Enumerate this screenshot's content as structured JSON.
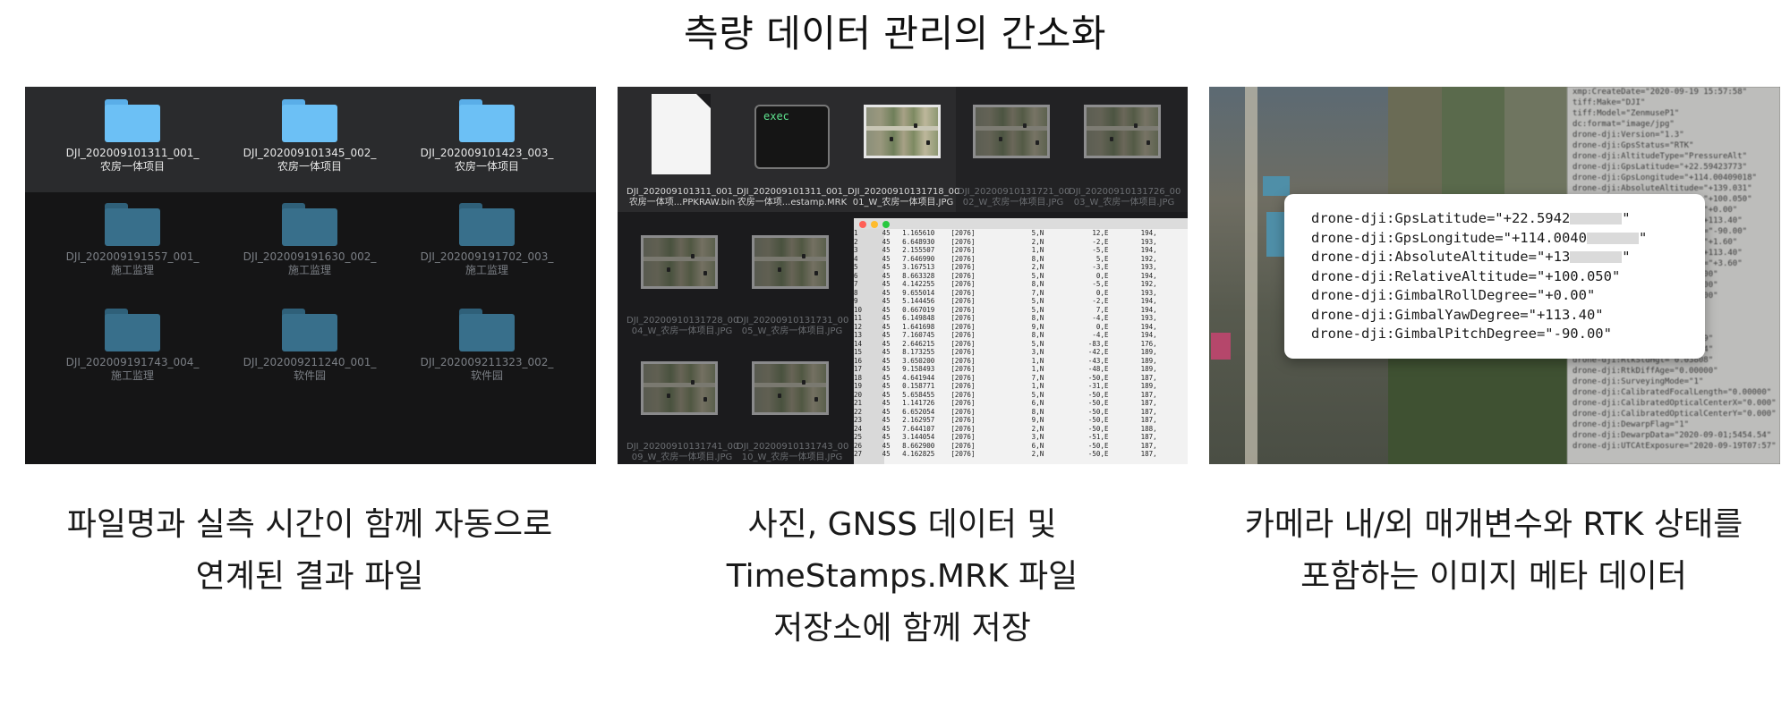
{
  "page": {
    "title": "측량 데이터 관리의 간소화"
  },
  "panels": [
    {
      "caption": [
        "파일명과 실측 시간이 함께 자동으로",
        "연계된 결과 파일"
      ],
      "folders": [
        {
          "line1": "DJI_202009101311_001_",
          "line2": "农房一体项目",
          "active": true
        },
        {
          "line1": "DJI_202009101345_002_",
          "line2": "农房一体项目",
          "active": true
        },
        {
          "line1": "DJI_202009101423_003_",
          "line2": "农房一体项目",
          "active": true
        },
        {
          "line1": "DJI_202009191557_001_",
          "line2": "施工监理",
          "active": false
        },
        {
          "line1": "DJI_202009191630_002_",
          "line2": "施工监理",
          "active": false
        },
        {
          "line1": "DJI_202009191702_003_",
          "line2": "施工监理",
          "active": false
        },
        {
          "line1": "DJI_202009191743_004_",
          "line2": "施工监理",
          "active": false
        },
        {
          "line1": "DJI_202009211240_001_",
          "line2": "软件园",
          "active": false
        },
        {
          "line1": "DJI_202009211323_002_",
          "line2": "软件园",
          "active": false
        }
      ]
    },
    {
      "caption": [
        "사진, GNSS 데이터 및",
        "TimeStamps.MRK 파일",
        "저장소에 함께 저장"
      ],
      "terminal_label": "exec",
      "files": [
        {
          "line1": "DJI_202009101311_001_",
          "line2": "农房一体项...PPKRAW.bin"
        },
        {
          "line1": "DJI_202009101311_001_",
          "line2": "农房一体项...estamp.MRK"
        },
        {
          "line1": "DJI_20200910131718_00",
          "line2": "01_W_农房一体项目.JPG"
        },
        {
          "line1": "DJI_20200910131721_00",
          "line2": "02_W_农房一体项目.JPG"
        },
        {
          "line1": "DJI_20200910131726_00",
          "line2": "03_W_农房一体项目.JPG"
        },
        {
          "line1": "DJI_20200910131728_00",
          "line2": "04_W_农房一体项目.JPG"
        },
        {
          "line1": "DJI_20200910131731_00",
          "line2": "05_W_农房一体项目.JPG"
        },
        {
          "line1": "DJI_20200910131741_00",
          "line2": "09_W_农房一体项目.JPG"
        },
        {
          "line1": "DJI_20200910131743_00",
          "line2": "10_W_农房一体项目.JPG"
        }
      ],
      "mrk_rows": [
        [
          "1",
          "45",
          "1.165610",
          "[2076]",
          "5,N",
          "12,E",
          "194,"
        ],
        [
          "2",
          "45",
          "6.648930",
          "[2076]",
          "2,N",
          "-2,E",
          "193,"
        ],
        [
          "3",
          "45",
          "2.155507",
          "[2076]",
          "1,N",
          "-5,E",
          "194,"
        ],
        [
          "4",
          "45",
          "7.646990",
          "[2076]",
          "8,N",
          "5,E",
          "192,"
        ],
        [
          "5",
          "45",
          "3.167513",
          "[2076]",
          "2,N",
          "-3,E",
          "193,"
        ],
        [
          "6",
          "45",
          "8.663328",
          "[2076]",
          "5,N",
          "0,E",
          "194,"
        ],
        [
          "7",
          "45",
          "4.142255",
          "[2076]",
          "8,N",
          "-5,E",
          "192,"
        ],
        [
          "8",
          "45",
          "9.655014",
          "[2076]",
          "7,N",
          "0,E",
          "193,"
        ],
        [
          "9",
          "45",
          "5.144456",
          "[2076]",
          "5,N",
          "-2,E",
          "194,"
        ],
        [
          "10",
          "45",
          "0.667019",
          "[2076]",
          "5,N",
          "7,E",
          "194,"
        ],
        [
          "11",
          "45",
          "6.149848",
          "[2076]",
          "8,N",
          "-4,E",
          "193,"
        ],
        [
          "12",
          "45",
          "1.641698",
          "[2076]",
          "9,N",
          "0,E",
          "194,"
        ],
        [
          "13",
          "45",
          "7.160745",
          "[2076]",
          "8,N",
          "-4,E",
          "194,"
        ],
        [
          "14",
          "45",
          "2.646215",
          "[2076]",
          "5,N",
          "-83,E",
          "176,"
        ],
        [
          "15",
          "45",
          "8.173255",
          "[2076]",
          "3,N",
          "-42,E",
          "189,"
        ],
        [
          "16",
          "45",
          "3.650200",
          "[2076]",
          "1,N",
          "-43,E",
          "189,"
        ],
        [
          "17",
          "45",
          "9.158493",
          "[2076]",
          "1,N",
          "-48,E",
          "189,"
        ],
        [
          "18",
          "45",
          "4.641944",
          "[2076]",
          "7,N",
          "-50,E",
          "187,"
        ],
        [
          "19",
          "45",
          "0.158771",
          "[2076]",
          "1,N",
          "-31,E",
          "189,"
        ],
        [
          "20",
          "45",
          "5.658455",
          "[2076]",
          "5,N",
          "-50,E",
          "187,"
        ],
        [
          "21",
          "45",
          "1.141726",
          "[2076]",
          "6,N",
          "-50,E",
          "187,"
        ],
        [
          "22",
          "45",
          "6.652054",
          "[2076]",
          "8,N",
          "-50,E",
          "187,"
        ],
        [
          "23",
          "45",
          "2.162957",
          "[2076]",
          "9,N",
          "-50,E",
          "187,"
        ],
        [
          "24",
          "45",
          "7.644107",
          "[2076]",
          "2,N",
          "-50,E",
          "188,"
        ],
        [
          "25",
          "45",
          "3.144054",
          "[2076]",
          "3,N",
          "-51,E",
          "187,"
        ],
        [
          "26",
          "45",
          "8.662900",
          "[2076]",
          "6,N",
          "-50,E",
          "187,"
        ],
        [
          "27",
          "45",
          "4.162825",
          "[2076]",
          "2,N",
          "-50,E",
          "187,"
        ]
      ]
    },
    {
      "caption": [
        "카메라 내/외 매개변수와 RTK 상태를",
        "포함하는 이미지 메타 데이터"
      ],
      "card_lines": [
        {
          "prefix": "drone-dji:GpsLatitude=\"+22.5942",
          "masked": true,
          "suffix": "\""
        },
        {
          "prefix": "drone-dji:GpsLongitude=\"+114.0040",
          "masked": true,
          "suffix": "\""
        },
        {
          "prefix": "drone-dji:AbsoluteAltitude=\"+13",
          "masked": true,
          "suffix": "\""
        },
        {
          "prefix": "drone-dji:RelativeAltitude=\"+100.050\"",
          "masked": false,
          "suffix": ""
        },
        {
          "prefix": "drone-dji:GimbalRollDegree=\"+0.00\"",
          "masked": false,
          "suffix": ""
        },
        {
          "prefix": "drone-dji:GimbalYawDegree=\"+113.40\"",
          "masked": false,
          "suffix": ""
        },
        {
          "prefix": "drone-dji:GimbalPitchDegree=\"-90.00\"",
          "masked": false,
          "suffix": ""
        }
      ],
      "background_meta": [
        "xmp:CreateDate=\"2020-09-19 15:57:58\"",
        "tiff:Make=\"DJI\"",
        "tiff:Model=\"ZenmuseP1\"",
        "dc:format=\"image/jpg\"",
        "drone-dji:Version=\"1.3\"",
        "drone-dji:GpsStatus=\"RTK\"",
        "drone-dji:AltitudeType=\"PressureAlt\"",
        "drone-dji:GpsLatitude=\"+22.59423773\"",
        "drone-dji:GpsLongitude=\"+114.00409018\"",
        "drone-dji:AbsoluteAltitude=\"+139.031\"",
        "drone-dji:RelativeAltitude=\"+100.050\"",
        "drone-dji:GimbalRollDegree=\"+0.00\"",
        "drone-dji:GimbalYawDegree=\"+113.40\"",
        "drone-dji:GimbalPitchDegree=\"-90.00\"",
        "drone-dji:FlightRollDegree=\"+1.60\"",
        "drone-dji:FlightYawDegree=\"+113.40\"",
        "drone-dji:FlightPitchDegree=\"+3.60\"",
        "drone-dji:FlightXSpeed=\"+0.00\"",
        "drone-dji:FlightYSpeed=\"+0.00\"",
        "drone-dji:FlightZSpeed=\"+0.00\"",
        "drone-dji:CamReverse=\"0\"",
        "drone-dji:GimbalReverse=\"0\"",
        "drone-dji:RtkFlag=\"50\"",
        "drone-dji:RtkStdLon=\"0.01239\"",
        "drone-dji:RtkStdLat=\"0.01364\"",
        "drone-dji:RtkStdHgt=\"0.03808\"",
        "drone-dji:RtkDiffAge=\"0.00000\"",
        "drone-dji:SurveyingMode=\"1\"",
        "drone-dji:CalibratedFocalLength=\"0.00000\"",
        "drone-dji:CalibratedOpticalCenterX=\"0.000\"",
        "drone-dji:CalibratedOpticalCenterY=\"0.000\"",
        "drone-dji:DewarpFlag=\"1\"",
        "drone-dji:DewarpData=\"2020-09-01;5454.54\"",
        "drone-dji:UTCAtExposure=\"2020-09-19T07:57\""
      ]
    }
  ],
  "colors": {
    "folder_bright": "#6cc0f5",
    "folder_dim": "#386f8b",
    "terminal_text": "#5ee38e",
    "mac_red": "#ff5f57",
    "mac_yellow": "#febc2e",
    "mac_green": "#28c840"
  }
}
